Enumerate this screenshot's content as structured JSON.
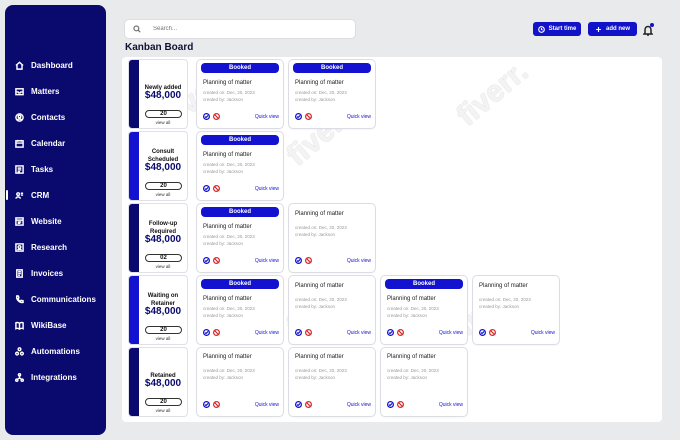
{
  "sidebar": {
    "items": [
      {
        "label": "Dashboard",
        "icon": "home-icon"
      },
      {
        "label": "Matters",
        "icon": "inbox-icon"
      },
      {
        "label": "Contacts",
        "icon": "user-circle-icon"
      },
      {
        "label": "Calendar",
        "icon": "calendar-icon"
      },
      {
        "label": "Tasks",
        "icon": "checklist-icon"
      },
      {
        "label": "CRM",
        "icon": "crm-icon",
        "active": true
      },
      {
        "label": "Website",
        "icon": "website-icon"
      },
      {
        "label": "Research",
        "icon": "research-icon"
      },
      {
        "label": "Invoices",
        "icon": "invoice-icon"
      },
      {
        "label": "Communications",
        "icon": "phone-icon"
      },
      {
        "label": "WikiBase",
        "icon": "book-icon"
      },
      {
        "label": "Automations",
        "icon": "automation-icon"
      },
      {
        "label": "Integrations",
        "icon": "integration-icon"
      }
    ]
  },
  "header": {
    "search_placeholder": "Search...",
    "start_timer_label": "Start time",
    "add_new_label": "add new",
    "page_title": "Kanban Board"
  },
  "colors": {
    "sidebar": "#0a0a6e",
    "accent": "#1212d0",
    "reject": "#d62b2b"
  },
  "columns": [
    {
      "name": "Newly added",
      "value": "$48,000",
      "count": "20",
      "view_all": "view all",
      "bar": "dark",
      "cards": [
        {
          "badge": "Booked",
          "title": "Planning of matter",
          "created_on": "created on:  Dec, 20, 2023",
          "created_by": "created by:  Jackson",
          "quick_view": "Quick view"
        },
        {
          "badge": "Booked",
          "title": "Planning of matter",
          "created_on": "created on:  Dec, 20, 2023",
          "created_by": "created by:  Jackson",
          "quick_view": "Quick view"
        }
      ]
    },
    {
      "name": "Consult Scheduled",
      "value": "$48,000",
      "count": "20",
      "view_all": "view all",
      "bar": "blue",
      "cards": [
        {
          "badge": "Booked",
          "title": "Planning of matter",
          "created_on": "created on:  Dec, 20, 2023",
          "created_by": "created by:  Jackson",
          "quick_view": "Quick view"
        }
      ]
    },
    {
      "name": "Follow-up Required",
      "value": "$48,000",
      "count": "02",
      "view_all": "view all",
      "bar": "dark",
      "cards": [
        {
          "badge": "Booked",
          "title": "Planning of matter",
          "created_on": "created on:  Dec, 20, 2023",
          "created_by": "created by:  Jackson",
          "quick_view": "Quick view"
        },
        {
          "badge": "",
          "title": "Planning of matter",
          "created_on": "created on:  Dec, 20, 2023",
          "created_by": "created by:  Jackson",
          "quick_view": "Quick view"
        }
      ]
    },
    {
      "name": "Waiting on Retainer",
      "value": "$48,000",
      "count": "20",
      "view_all": "view all",
      "bar": "blue",
      "cards": [
        {
          "badge": "Booked",
          "title": "Planning of matter",
          "created_on": "created on:  Dec, 20, 2023",
          "created_by": "created by:  Jackson",
          "quick_view": "Quick view"
        },
        {
          "badge": "",
          "title": "Planning of matter",
          "created_on": "created on:  Dec, 20, 2023",
          "created_by": "created by:  Jackson",
          "quick_view": "Quick view"
        },
        {
          "badge": "Booked",
          "title": "Planning of matter",
          "created_on": "created on:  Dec, 20, 2023",
          "created_by": "created by:  Jackson",
          "quick_view": "Quick view"
        },
        {
          "badge": "",
          "title": "Planning of matter",
          "created_on": "created on:  Dec, 20, 2023",
          "created_by": "created by:  Jackson",
          "quick_view": "Quick view"
        }
      ]
    },
    {
      "name": "Retained",
      "value": "$48,000",
      "count": "20",
      "view_all": "view all",
      "bar": "dark",
      "cards": [
        {
          "badge": "",
          "title": "Planning of matter",
          "created_on": "created on:  Dec, 20, 2023",
          "created_by": "created by:  Jackson",
          "quick_view": "Quick view"
        },
        {
          "badge": "",
          "title": "Planning of matter",
          "created_on": "created on:  Dec, 20, 2023",
          "created_by": "created by:  Jackson",
          "quick_view": "Quick view"
        },
        {
          "badge": "",
          "title": "Planning of matter",
          "created_on": "created on:  Dec, 20, 2023",
          "created_by": "created by:  Jackson",
          "quick_view": "Quick view"
        }
      ]
    }
  ],
  "watermark": "fiverr."
}
